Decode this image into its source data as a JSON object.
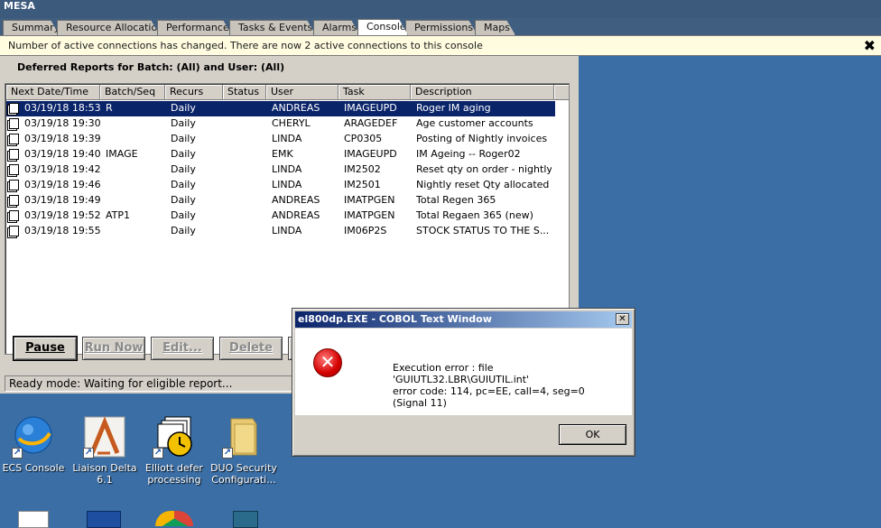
{
  "app": {
    "title": "MESA"
  },
  "tabs": [
    {
      "label": "Summary"
    },
    {
      "label": "Resource Allocation"
    },
    {
      "label": "Performance"
    },
    {
      "label": "Tasks & Events"
    },
    {
      "label": "Alarms"
    },
    {
      "label": "Console",
      "active": true
    },
    {
      "label": "Permissions"
    },
    {
      "label": "Maps"
    }
  ],
  "notification": {
    "text": "Number of active connections has changed. There are now 2 active connections to this console",
    "close_symbol": "✖"
  },
  "panel": {
    "heading": "Deferred Reports for Batch:  (All) and User:  (All)",
    "columns": [
      "Next Date/Time",
      "Batch/Seq",
      "Recurs",
      "Status",
      "User",
      "Task",
      "Description"
    ],
    "rows": [
      {
        "datetime": "03/19/18 18:53",
        "batch": "R",
        "recurs": "Daily",
        "status": "",
        "user": "ANDREAS",
        "task": "IMAGEUPD",
        "description": "Roger IM aging",
        "selected": true
      },
      {
        "datetime": "03/19/18 19:30",
        "batch": "",
        "recurs": "Daily",
        "status": "",
        "user": "CHERYL",
        "task": "ARAGEDEF",
        "description": "Age customer accounts"
      },
      {
        "datetime": "03/19/18 19:39",
        "batch": "",
        "recurs": "Daily",
        "status": "",
        "user": "LINDA",
        "task": "CP0305",
        "description": "Posting of Nightly invoices"
      },
      {
        "datetime": "03/19/18 19:40",
        "batch": "IMAGE",
        "recurs": "Daily",
        "status": "",
        "user": "EMK",
        "task": "IMAGEUPD",
        "description": "IM Ageing -- Roger02"
      },
      {
        "datetime": "03/19/18 19:42",
        "batch": "",
        "recurs": "Daily",
        "status": "",
        "user": "LINDA",
        "task": "IM2502",
        "description": "Reset qty on order - nightly"
      },
      {
        "datetime": "03/19/18 19:46",
        "batch": "",
        "recurs": "Daily",
        "status": "",
        "user": "LINDA",
        "task": "IM2501",
        "description": "Nightly reset Qty allocated"
      },
      {
        "datetime": "03/19/18 19:49",
        "batch": "",
        "recurs": "Daily",
        "status": "",
        "user": "ANDREAS",
        "task": "IMATPGEN",
        "description": "Total Regen 365"
      },
      {
        "datetime": "03/19/18 19:52",
        "batch": "ATP1",
        "recurs": "Daily",
        "status": "",
        "user": "ANDREAS",
        "task": "IMATPGEN",
        "description": "Total Regaen 365 (new)"
      },
      {
        "datetime": "03/19/18 19:55",
        "batch": "",
        "recurs": "Daily",
        "status": "",
        "user": "LINDA",
        "task": "IM06P2S",
        "description": "STOCK STATUS TO THE S..."
      }
    ],
    "buttons": {
      "pause": "Pause",
      "run_now": "Run Now",
      "edit": "Edit...",
      "delete": "Delete"
    },
    "status": "Ready mode: Waiting for eligible report..."
  },
  "desktop": {
    "icons": [
      {
        "label": "ECS Console",
        "icon": "globe-icon"
      },
      {
        "label": "Liaison Delta 6.1",
        "icon": "delta-icon"
      },
      {
        "label": "Elliott defer processing",
        "icon": "clock-documents-icon"
      },
      {
        "label": "DUO Security Configurati...",
        "icon": "folder-icon"
      }
    ]
  },
  "dialog": {
    "title": "el800dp.EXE - COBOL Text Window",
    "close_symbol": "✕",
    "message_line1": "Execution error : file 'GUIUTL32.LBR\\GUIUTIL.int'",
    "message_line2": "error code: 114, pc=EE, call=4, seg=0",
    "message_line3": "(Signal 11)",
    "ok_label": "OK"
  },
  "colors": {
    "desktop": "#3a6ea5",
    "selection": "#0a246a",
    "titlebar": "#3c5a7c"
  }
}
